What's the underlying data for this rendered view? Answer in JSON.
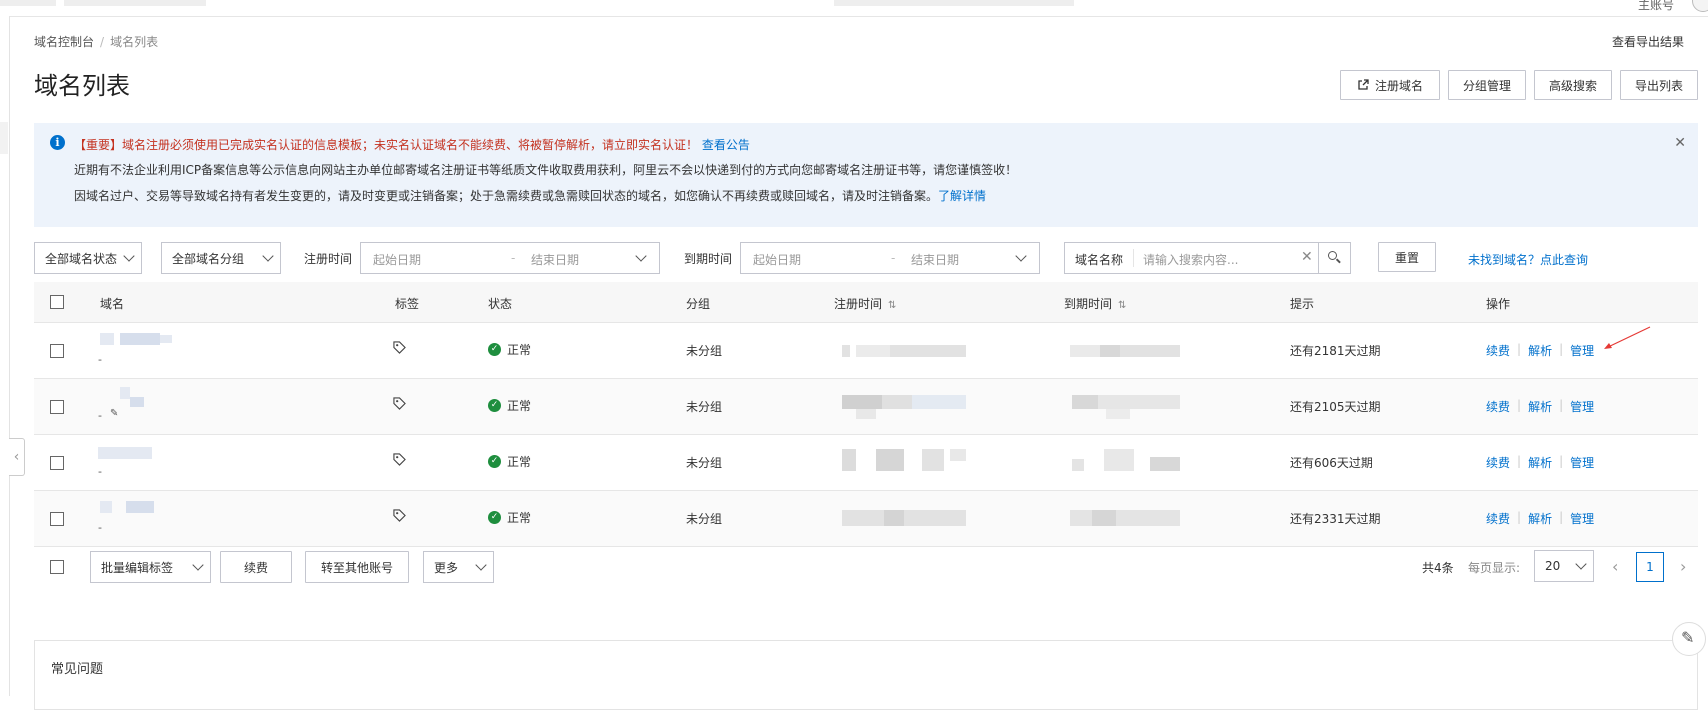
{
  "topbar": {
    "account": "主账号"
  },
  "breadcrumb": {
    "root": "域名控制台",
    "current": "域名列表"
  },
  "header": {
    "export_result": "查看导出结果",
    "title": "域名列表",
    "buttons": {
      "register": "注册域名",
      "group": "分组管理",
      "advanced": "高级搜索",
      "export": "导出列表"
    }
  },
  "notice": {
    "line1": "【重要】域名注册必须使用已完成实名认证的信息模板；未实名认证域名不能续费、将被暂停解析，请立即实名认证！",
    "line1_link": "查看公告",
    "line2": "近期有不法企业利用ICP备案信息等公示信息向网站主办单位邮寄域名注册证书等纸质文件收取费用获利，阿里云不会以快递到付的方式向您邮寄域名注册证书等，请您谨慎签收！",
    "line3": "因域名过户、交易等导致域名持有者发生变更的，请及时变更或注销备案；处于急需续费或急需赎回状态的域名，如您确认不再续费或赎回域名，请及时注销备案。",
    "line3_link": "了解详情"
  },
  "filters": {
    "status": "全部域名状态",
    "group": "全部域名分组",
    "reg_label": "注册时间",
    "exp_label": "到期时间",
    "start_ph": "起始日期",
    "end_ph": "结束日期",
    "search_field": "域名名称",
    "search_ph": "请输入搜索内容...",
    "reset": "重置",
    "not_found": "未找到域名？点此查询"
  },
  "table": {
    "headers": {
      "domain": "域名",
      "tag": "标签",
      "status": "状态",
      "group": "分组",
      "reg": "注册时间",
      "exp": "到期时间",
      "hint": "提示",
      "ops": "操作"
    },
    "rows": [
      {
        "dash": "-",
        "status": "正常",
        "group": "未分组",
        "hint": "还有2181天过期"
      },
      {
        "dash": "-",
        "status": "正常",
        "group": "未分组",
        "hint": "还有2105天过期"
      },
      {
        "dash": "-",
        "status": "正常",
        "group": "未分组",
        "hint": "还有606天过期"
      },
      {
        "dash": "-",
        "status": "正常",
        "group": "未分组",
        "hint": "还有2331天过期"
      }
    ],
    "ops": {
      "renew": "续费",
      "dns": "解析",
      "manage": "管理"
    }
  },
  "footer": {
    "batch_tag": "批量编辑标签",
    "renew": "续费",
    "transfer": "转至其他账号",
    "more": "更多",
    "total": "共4条",
    "per_page_label": "每页显示:",
    "per_page": "20",
    "page": "1"
  },
  "faq": {
    "title": "常见问题"
  }
}
